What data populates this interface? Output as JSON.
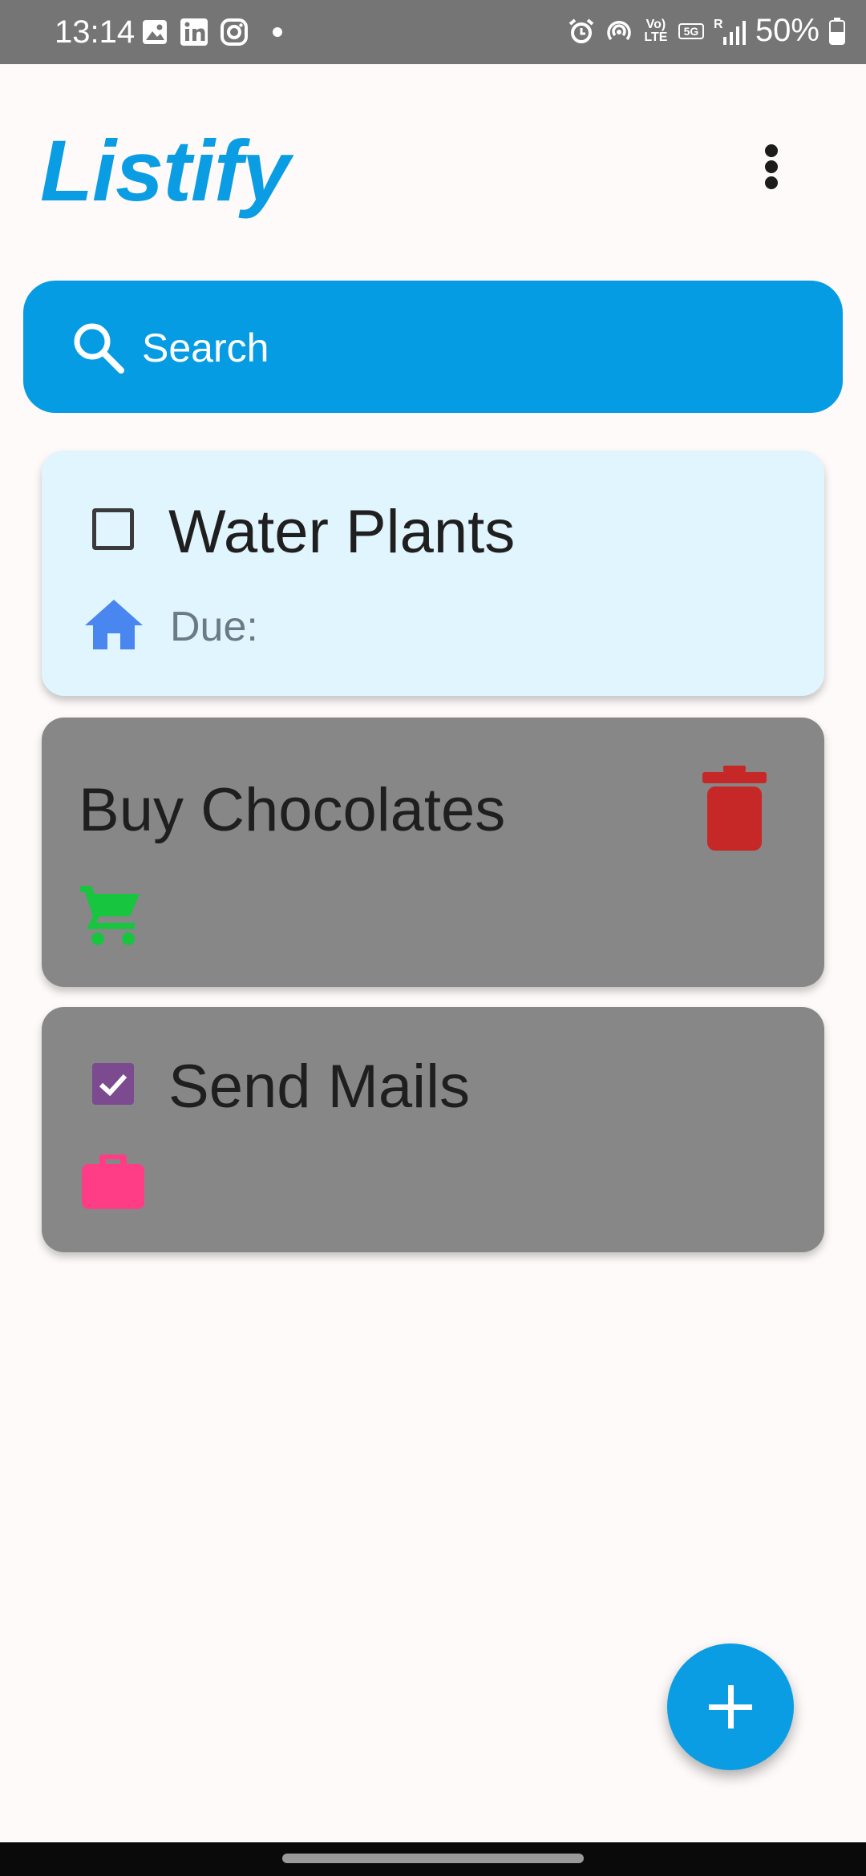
{
  "status_bar": {
    "time": "13:14",
    "battery": "50%",
    "network_label": "5G",
    "volte_label": "Vo) LTE",
    "roaming_label": "R"
  },
  "app": {
    "title": "Listify",
    "accent_color": "#0a9de3"
  },
  "search": {
    "placeholder": "Search"
  },
  "tasks": [
    {
      "title": "Water Plants",
      "checked": false,
      "due_label": "Due:",
      "category_icon": "home-icon",
      "category_color": "#4a86f0",
      "background": "#e1f5fe"
    },
    {
      "title": "Buy Chocolates",
      "category_icon": "cart-icon",
      "category_color": "#17c53f",
      "delete_icon": "trash-icon",
      "delete_color": "#c62828",
      "background": "#878787"
    },
    {
      "title": "Send Mails",
      "checked": true,
      "category_icon": "briefcase-icon",
      "category_color": "#ff3d86",
      "background": "#878787"
    }
  ],
  "fab": {
    "icon": "plus-icon"
  }
}
